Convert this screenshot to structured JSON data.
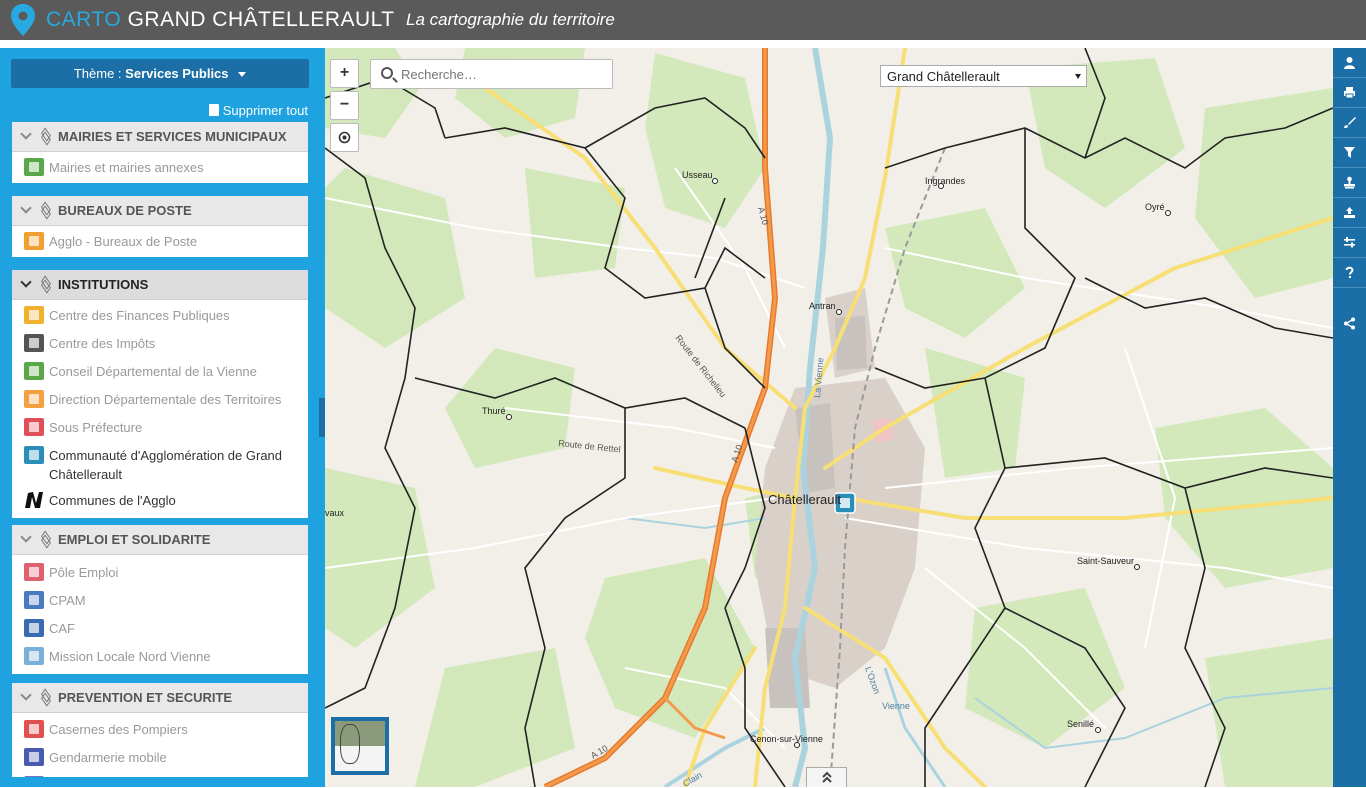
{
  "header": {
    "logo_carto": "CARTO",
    "logo_grand": "GRAND",
    "logo_city": "CHÂTELLERAULT",
    "tagline": "La cartographie du territoire"
  },
  "sidebar": {
    "theme_prefix": "Thème :",
    "theme_value": "Services Publics",
    "remove_all": "Supprimer tout",
    "groups": [
      {
        "title": "MAIRIES ET SERVICES MUNICIPAUX",
        "active": false,
        "items": [
          {
            "label": "Mairies et mairies annexes",
            "color": "#5aa74a",
            "on": false
          }
        ]
      },
      {
        "title": "BUREAUX DE POSTE",
        "active": false,
        "items": [
          {
            "label": "Agglo - Bureaux de Poste",
            "color": "#f0a030",
            "on": false
          }
        ]
      },
      {
        "title": "INSTITUTIONS",
        "active": true,
        "items": [
          {
            "label": "Centre des Finances Publiques",
            "color": "#f0b030",
            "on": false
          },
          {
            "label": "Centre des Impôts",
            "color": "#555555",
            "on": false
          },
          {
            "label": "Conseil Départemental de la Vienne",
            "color": "#5aa74a",
            "on": false
          },
          {
            "label": "Direction Départementale des Territoires",
            "color": "#f5a040",
            "on": false
          },
          {
            "label": "Sous Préfecture",
            "color": "#e0505a",
            "on": false
          },
          {
            "label": "Communauté d'Agglomération de Grand Châtellerault",
            "color": "#2a8fb8",
            "on": true
          },
          {
            "label": "Communes de l'Agglo",
            "color": "#111111",
            "on": true
          }
        ]
      },
      {
        "title": "EMPLOI ET SOLIDARITE",
        "active": false,
        "items": [
          {
            "label": "Pôle Emploi",
            "color": "#e06070",
            "on": false
          },
          {
            "label": "CPAM",
            "color": "#4a7ac0",
            "on": false
          },
          {
            "label": "CAF",
            "color": "#3a6ab0",
            "on": false
          },
          {
            "label": "Mission Locale Nord Vienne",
            "color": "#7ab0d8",
            "on": false
          }
        ]
      },
      {
        "title": "PREVENTION ET SECURITE",
        "active": false,
        "items": [
          {
            "label": "Casernes des Pompiers",
            "color": "#e05050",
            "on": false
          },
          {
            "label": "Gendarmerie mobile",
            "color": "#4a5ab0",
            "on": false
          }
        ]
      }
    ]
  },
  "map": {
    "zoom_in": "+",
    "zoom_out": "−",
    "search_placeholder": "Recherche…",
    "commune_selected": "Grand Châtellerault",
    "places": [
      {
        "name": "Usseau"
      },
      {
        "name": "Ingrandes"
      },
      {
        "name": "Oyré"
      },
      {
        "name": "Antran"
      },
      {
        "name": "Thuré"
      },
      {
        "name": "Châtellerault"
      },
      {
        "name": "Saint-Sauveur"
      },
      {
        "name": "Senillé"
      },
      {
        "name": "Cenon-sur-Vienne"
      },
      {
        "name": "vaux"
      }
    ],
    "road_labels": [
      "A 10",
      "A 10",
      "A 10",
      "Route de Richelieu",
      "Route de Rettel",
      "La Vienne",
      "L'Ozon",
      "Vienne",
      "Clain"
    ]
  },
  "toolbar": {
    "tools": [
      "user-icon",
      "print-icon",
      "brush-icon",
      "filter-icon",
      "stamp-icon",
      "upload-icon",
      "sliders-icon",
      "help-icon",
      "share-icon"
    ]
  }
}
